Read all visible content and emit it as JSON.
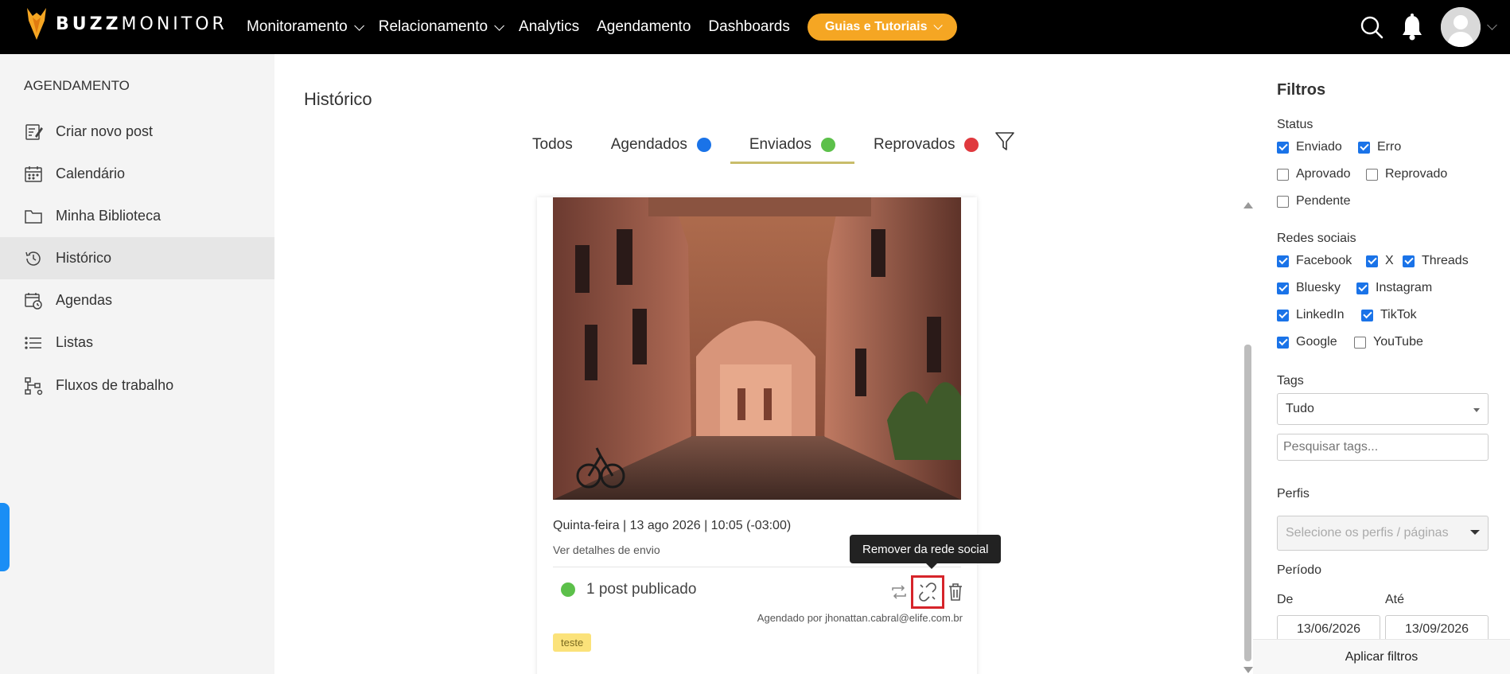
{
  "brand": {
    "name_bold": "BUZZ",
    "name_light": "MONITOR",
    "accent": "#f5a623"
  },
  "nav": {
    "items": [
      {
        "label": "Monitoramento",
        "dropdown": true
      },
      {
        "label": "Relacionamento",
        "dropdown": true
      },
      {
        "label": "Analytics",
        "dropdown": false
      },
      {
        "label": "Agendamento",
        "dropdown": false
      },
      {
        "label": "Dashboards",
        "dropdown": false
      }
    ],
    "guides_label": "Guias e Tutoriais"
  },
  "sidebar": {
    "title": "AGENDAMENTO",
    "items": [
      {
        "label": "Criar novo post",
        "icon": "edit-icon"
      },
      {
        "label": "Calendário",
        "icon": "calendar-icon"
      },
      {
        "label": "Minha Biblioteca",
        "icon": "folder-icon"
      },
      {
        "label": "Histórico",
        "icon": "history-icon",
        "active": true
      },
      {
        "label": "Agendas",
        "icon": "schedule-icon"
      },
      {
        "label": "Listas",
        "icon": "list-icon"
      },
      {
        "label": "Fluxos de trabalho",
        "icon": "workflow-icon"
      }
    ]
  },
  "main": {
    "title": "Histórico",
    "tabs": [
      {
        "label": "Todos",
        "dot": null
      },
      {
        "label": "Agendados",
        "dot": "#1a73e8"
      },
      {
        "label": "Enviados",
        "dot": "#5cc04a",
        "active": true
      },
      {
        "label": "Reprovados",
        "dot": "#e0393e"
      }
    ]
  },
  "post": {
    "date": "Quinta-feira | 13 ago 2026 | 10:05 (-03:00)",
    "details_link": "Ver detalhes de envio",
    "status": "1 post publicado",
    "scheduled_by": "Agendado por jhonattan.cabral@elife.com.br",
    "tag": "teste",
    "tooltip": "Remover da rede social"
  },
  "filters": {
    "title": "Filtros",
    "status_label": "Status",
    "status": [
      {
        "label": "Enviado",
        "checked": true
      },
      {
        "label": "Erro",
        "checked": true
      },
      {
        "label": "Aprovado",
        "checked": false
      },
      {
        "label": "Reprovado",
        "checked": false
      },
      {
        "label": "Pendente",
        "checked": false
      }
    ],
    "networks_label": "Redes sociais",
    "networks": [
      {
        "label": "Facebook",
        "checked": true
      },
      {
        "label": "X",
        "checked": true
      },
      {
        "label": "Threads",
        "checked": true
      },
      {
        "label": "Bluesky",
        "checked": true
      },
      {
        "label": "Instagram",
        "checked": true
      },
      {
        "label": "LinkedIn",
        "checked": true
      },
      {
        "label": "TikTok",
        "checked": true
      },
      {
        "label": "Google",
        "checked": true
      },
      {
        "label": "YouTube",
        "checked": false
      }
    ],
    "tags_label": "Tags",
    "tags_value": "Tudo",
    "tags_search_placeholder": "Pesquisar tags...",
    "profiles_label": "Perfis",
    "profiles_placeholder": "Selecione os perfis / páginas",
    "period_label": "Período",
    "from_label": "De",
    "to_label": "Até",
    "from_value": "13/06/2026",
    "to_value": "13/09/2026",
    "apply_label": "Aplicar filtros"
  }
}
